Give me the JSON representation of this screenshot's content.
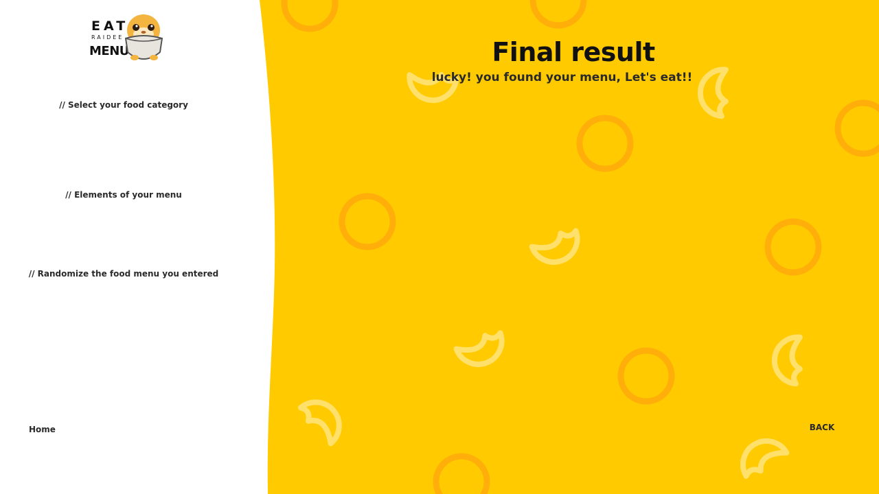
{
  "sidebar": {
    "logo": {
      "line1": "EAT",
      "line2": "RAIDEE",
      "line3": "MENU"
    },
    "steps": [
      "// Select your food category",
      "// Elements of your menu",
      "// Randomize the food menu you entered"
    ],
    "home_label": "Home"
  },
  "main": {
    "title": "Final result",
    "subtitle": "lucky! you found your menu, Let's eat!!",
    "back_label": "BACK"
  },
  "colors": {
    "background": "#ffca00",
    "ring": "#ffae0a",
    "crescent": "#ffe06a",
    "sidebar": "#ffffff",
    "text": "#2a2a2a"
  }
}
